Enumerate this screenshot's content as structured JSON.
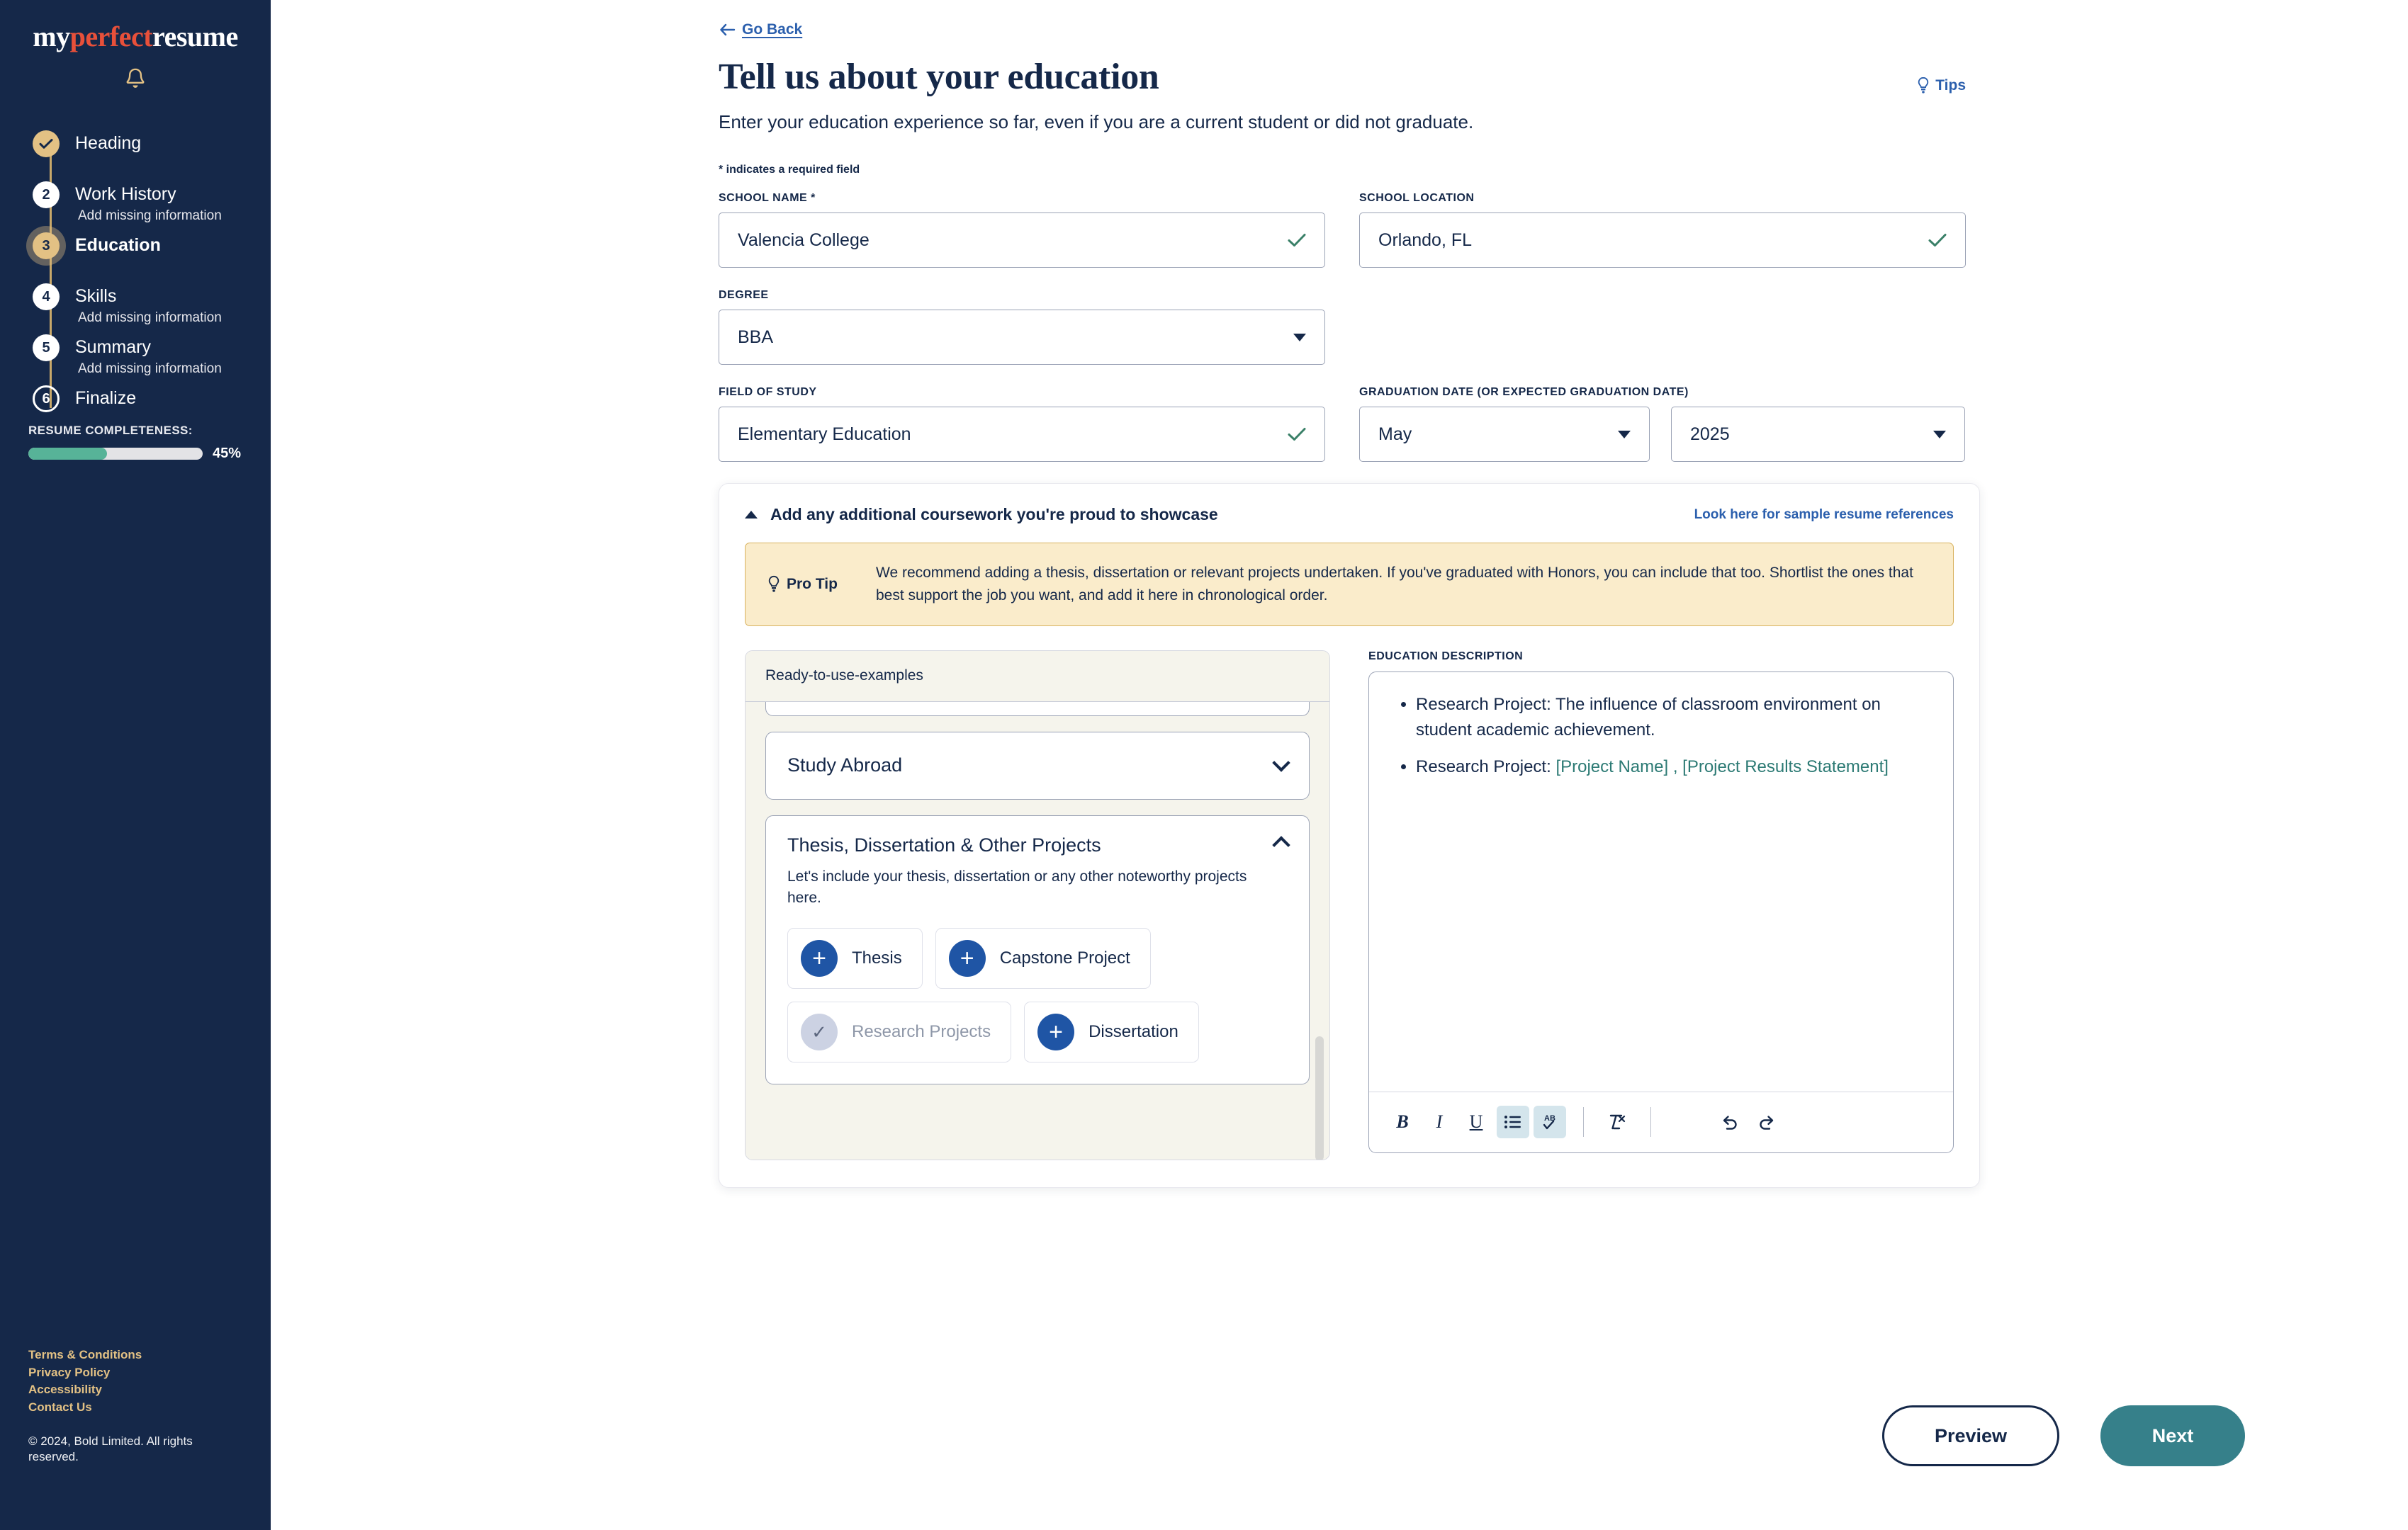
{
  "sidebar": {
    "brand": {
      "part1": "my",
      "part2": "perfect",
      "part3": "resume"
    },
    "notification_icon": "bell-icon",
    "steps": [
      {
        "num": "",
        "label": "Heading",
        "sub": "",
        "state": "done"
      },
      {
        "num": "2",
        "label": "Work History",
        "sub": "Add missing information",
        "state": "todo"
      },
      {
        "num": "3",
        "label": "Education",
        "sub": "",
        "state": "active"
      },
      {
        "num": "4",
        "label": "Skills",
        "sub": "Add missing information",
        "state": "todo"
      },
      {
        "num": "5",
        "label": "Summary",
        "sub": "Add missing information",
        "state": "todo"
      },
      {
        "num": "6",
        "label": "Finalize",
        "sub": "",
        "state": "outline"
      }
    ],
    "completeness": {
      "label": "RESUME COMPLETENESS:",
      "percent_label": "45%",
      "percent_value": 45,
      "fill_color": "#57b398",
      "track_color": "#e3e3e6"
    },
    "footer_links": [
      "Terms & Conditions",
      "Privacy Policy",
      "Accessibility",
      "Contact Us"
    ],
    "copyright": "© 2024, Bold Limited. All rights reserved.",
    "bg_color": "#152849",
    "accent_color": "#e3c184"
  },
  "header": {
    "go_back": "Go Back",
    "title": "Tell us about your education",
    "subtitle": "Enter your education experience so far, even if you are a current student or did not graduate.",
    "tips_label": "Tips",
    "required_note": "* indicates a required field"
  },
  "form": {
    "school_name": {
      "label": "SCHOOL NAME *",
      "value": "Valencia College",
      "valid": true
    },
    "school_location": {
      "label": "SCHOOL LOCATION",
      "value": "Orlando, FL",
      "valid": true
    },
    "degree": {
      "label": "DEGREE",
      "value": "BBA"
    },
    "field_of_study": {
      "label": "FIELD OF STUDY",
      "value": "Elementary Education",
      "valid": true
    },
    "graduation_date": {
      "label": "GRADUATION DATE (OR EXPECTED GRADUATION DATE)",
      "month": "May",
      "year": "2025"
    }
  },
  "coursework": {
    "header_title": "Add any additional coursework you're proud to showcase",
    "sample_link": "Look here for sample resume references",
    "pro_tip": {
      "badge": "Pro Tip",
      "text": "We recommend adding a thesis, dissertation or relevant projects undertaken. If you've graduated with Honors, you can include that too. Shortlist the ones that best support the job you want, and add it here in chronological order."
    },
    "examples_panel": {
      "header": "Ready-to-use-examples",
      "collapsed_item": "Study Abroad",
      "expanded_item": {
        "title": "Thesis, Dissertation & Other Projects",
        "description": "Let's include your thesis, dissertation or any other noteworthy projects here.",
        "chips": [
          {
            "label": "Thesis",
            "added": false
          },
          {
            "label": "Capstone Project",
            "added": false
          },
          {
            "label": "Research Projects",
            "added": true
          },
          {
            "label": "Dissertation",
            "added": false
          }
        ]
      }
    },
    "description": {
      "label": "EDUCATION DESCRIPTION",
      "bullets": [
        {
          "text": "Research Project: The influence of classroom environment on student academic achievement.",
          "placeholder": ""
        },
        {
          "text": "Research Project: ",
          "placeholder": "[Project Name] , [Project Results Statement]"
        }
      ],
      "toolbar": [
        {
          "name": "bold",
          "glyph": "B",
          "active": false
        },
        {
          "name": "italic",
          "glyph": "I",
          "active": false
        },
        {
          "name": "underline",
          "glyph": "U",
          "active": false
        },
        {
          "name": "bullet-list",
          "glyph": "list",
          "active": true
        },
        {
          "name": "spellcheck",
          "glyph": "AB",
          "active": true
        },
        {
          "name": "clear-formatting",
          "glyph": "clear",
          "active": false
        },
        {
          "name": "undo",
          "glyph": "undo",
          "active": false
        },
        {
          "name": "redo",
          "glyph": "redo",
          "active": false
        }
      ]
    }
  },
  "actions": {
    "preview": "Preview",
    "next": "Next",
    "next_color": "#36808a"
  }
}
